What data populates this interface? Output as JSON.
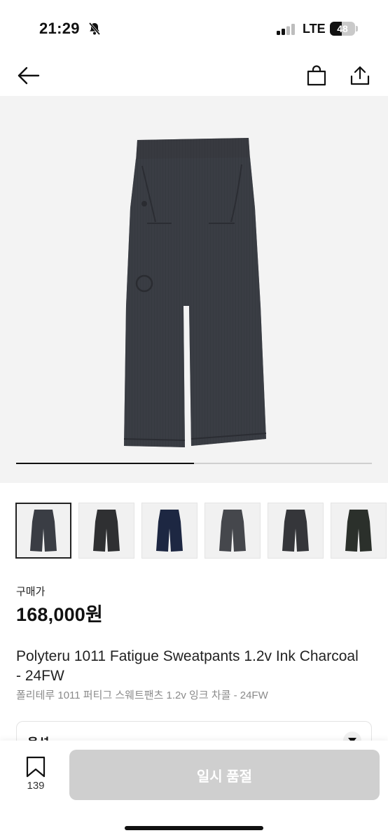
{
  "status": {
    "time": "21:29",
    "network": "LTE",
    "battery": "48",
    "battery_level": 0.48
  },
  "nav": {
    "back_icon": "arrow-left-icon",
    "bag_icon": "shopping-bag-icon",
    "share_icon": "share-icon"
  },
  "gallery": {
    "progress": 0.5,
    "thumbnails": [
      {
        "color": "#3a3d44",
        "selected": true
      },
      {
        "color": "#2f3032",
        "selected": false
      },
      {
        "color": "#1d2742",
        "selected": false
      },
      {
        "color": "#45474c",
        "selected": false
      },
      {
        "color": "#35363a",
        "selected": false
      },
      {
        "color": "#2b302b",
        "selected": false
      }
    ]
  },
  "product": {
    "price_label": "구매가",
    "price": "168,000원",
    "title_en": "Polyteru 1011 Fatigue Sweatpants 1.2v Ink Charcoal - 24FW",
    "title_ko": "폴리테루 1011 퍼티그 스웨트팬츠 1.2v 잉크 차콜 - 24FW"
  },
  "option": {
    "label": "옵션"
  },
  "bottom": {
    "wish_count": "139",
    "action_label": "일시 품절"
  },
  "colors": {
    "pants": "#3a3d44",
    "button_disabled": "#cfcfcf"
  }
}
